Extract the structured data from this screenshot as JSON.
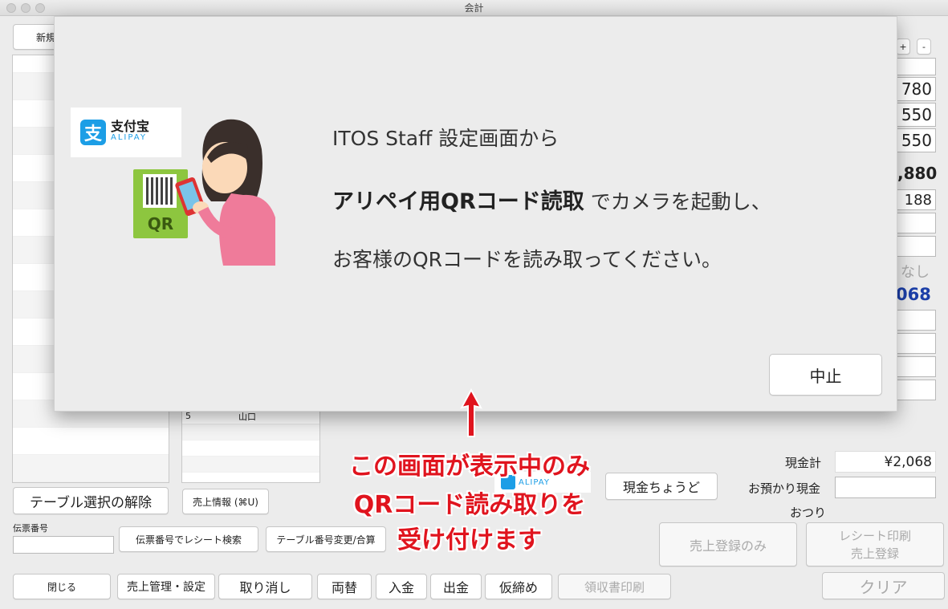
{
  "window": {
    "title": "会計"
  },
  "toolbar": {
    "new_label": "新規"
  },
  "zoom": {
    "plus": "+",
    "minus": "-"
  },
  "right_fields": {
    "v1": "780",
    "v2": "550",
    "v3": "550",
    "total": ",880",
    "v5": "188",
    "v_none": "なし",
    "v_blue": "068"
  },
  "seat_list": {
    "row5_num": "5",
    "row5_name": "山口"
  },
  "modal": {
    "alipay_cn": "支付宝",
    "alipay_en": "ALIPAY",
    "qr_text": "QR",
    "line1": "ITOS Staff 設定画面から",
    "line2_bold": "アリペイ用QRコード読取",
    "line2_rest": " でカメラを起動し、",
    "line3": "お客様のQRコードを読み取ってください。",
    "stop_button": "中止"
  },
  "annotation": {
    "line1": "この画面が表示中のみ",
    "line2": "QRコード読み取りを",
    "line3": "受け付けます"
  },
  "bottom": {
    "table_release": "テーブル選択の解除",
    "sales_info": "売上情報 (⌘U)",
    "slip_label": "伝票番号",
    "slip_value": "",
    "receipt_search": "伝票番号でレシート検索",
    "table_change": "テーブル番号変更/合算",
    "alipay_small": "ALIPAY",
    "cash_exact": "現金ちょうど",
    "cash_total_label": "現金計",
    "cash_total_value": "¥2,068",
    "deposit_label": "お預かり現金",
    "deposit_value": "",
    "change_label": "おつり",
    "register_only": "売上登録のみ",
    "receipt_print_1": "レシート印刷",
    "receipt_print_2": "売上登録",
    "close": "閉じる",
    "sales_manage": "売上管理・設定",
    "cancel": "取り消し",
    "exchange": "両替",
    "deposit": "入金",
    "withdraw": "出金",
    "provisional": "仮締め",
    "receipt_book": "領収書印刷",
    "clear": "クリア"
  },
  "colors": {
    "accent_blue": "#1c3fa8",
    "annot_red": "#e0141e",
    "alipay_blue": "#1c9ee6",
    "qr_green": "#8dc63f"
  }
}
